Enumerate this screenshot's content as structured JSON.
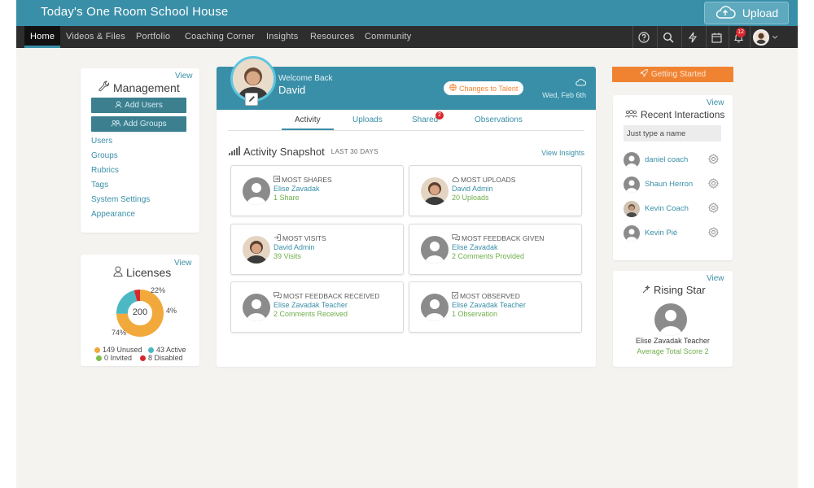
{
  "header": {
    "app_title": "Today's One Room School House",
    "upload_label": "Upload"
  },
  "nav": {
    "items": [
      {
        "label": "Home",
        "active": true
      },
      {
        "label": "Videos & Files"
      },
      {
        "label": "Portfolio"
      },
      {
        "label": "Coaching Corner"
      },
      {
        "label": "Insights"
      },
      {
        "label": "Resources"
      },
      {
        "label": "Community"
      }
    ],
    "icons": [
      "help-icon",
      "search-icon",
      "lightning-icon",
      "calendar-icon",
      "bell-icon",
      "avatar"
    ],
    "notification_count": "12"
  },
  "management": {
    "title": "Management",
    "view": "View",
    "add_users": "Add Users",
    "add_groups": "Add Groups",
    "links": [
      "Users",
      "Groups",
      "Rubrics",
      "Tags",
      "System Settings",
      "Appearance"
    ]
  },
  "licenses": {
    "title": "Licenses",
    "view": "View",
    "total": "200",
    "pct_active": "22%",
    "pct_disabled": "4%",
    "pct_unused": "74%",
    "segments": [
      {
        "label": "Unused",
        "count": 149,
        "color": "#f2a93b"
      },
      {
        "label": "Active",
        "count": 43,
        "color": "#4bb8c4"
      },
      {
        "label": "Invited",
        "count": 0,
        "color": "#7dbf4a"
      },
      {
        "label": "Disabled",
        "count": 8,
        "color": "#d8262d"
      }
    ],
    "legend": [
      "149 Unused",
      "43 Active",
      "0 Invited",
      "8 Disabled"
    ]
  },
  "profile": {
    "welcome": "Welcome Back",
    "name": "David",
    "changes_label": "Changes to Talent",
    "date": "Wed, Feb 6th"
  },
  "tabs": [
    {
      "label": "Activity",
      "active": true
    },
    {
      "label": "Uploads"
    },
    {
      "label": "Shared",
      "badge": "2"
    },
    {
      "label": "Observations"
    }
  ],
  "snapshot": {
    "title": "Activity Snapshot",
    "subtitle": "LAST 30 DAYS",
    "view_insights": "View Insights",
    "stats": [
      {
        "label": "MOST SHARES",
        "name": "Elise Zavadak",
        "value": "1 Share",
        "icon": "share-icon",
        "avatar": "placeholder"
      },
      {
        "label": "MOST UPLOADS",
        "name": "David Admin",
        "value": "20 Uploads",
        "icon": "upload-icon",
        "avatar": "photo"
      },
      {
        "label": "MOST VISITS",
        "name": "David Admin",
        "value": "39 Visits",
        "icon": "login-icon",
        "avatar": "photo"
      },
      {
        "label": "MOST FEEDBACK GIVEN",
        "name": "Elise Zavadak",
        "value": "2 Comments Provided",
        "icon": "comments-icon",
        "avatar": "placeholder"
      },
      {
        "label": "MOST FEEDBACK RECEIVED",
        "name": "Elise Zavadak Teacher",
        "value": "2 Comments Received",
        "icon": "comments-icon",
        "avatar": "placeholder"
      },
      {
        "label": "MOST OBSERVED",
        "name": "Elise Zavadak Teacher",
        "value": "1 Observation",
        "icon": "checkbox-icon",
        "avatar": "placeholder"
      }
    ]
  },
  "getting_started": "Getting Started",
  "recent": {
    "title": "Recent Interactions",
    "view": "View",
    "search_placeholder": "Just type a name",
    "people": [
      {
        "name": "daniel coach",
        "avatar": "placeholder"
      },
      {
        "name": "Shaun Herron",
        "avatar": "placeholder"
      },
      {
        "name": "Kevin Coach",
        "avatar": "photo"
      },
      {
        "name": "Kevin Pié",
        "avatar": "placeholder"
      }
    ]
  },
  "rising_star": {
    "title": "Rising Star",
    "view": "View",
    "name": "Elise Zavadak Teacher",
    "score": "Average Total Score 2"
  },
  "colors": {
    "brand": "#3a8fa8",
    "nav_bg": "#2d2d2d",
    "accent_orange": "#f08332",
    "green_text": "#6fae4a",
    "badge_red": "#d8262d"
  }
}
